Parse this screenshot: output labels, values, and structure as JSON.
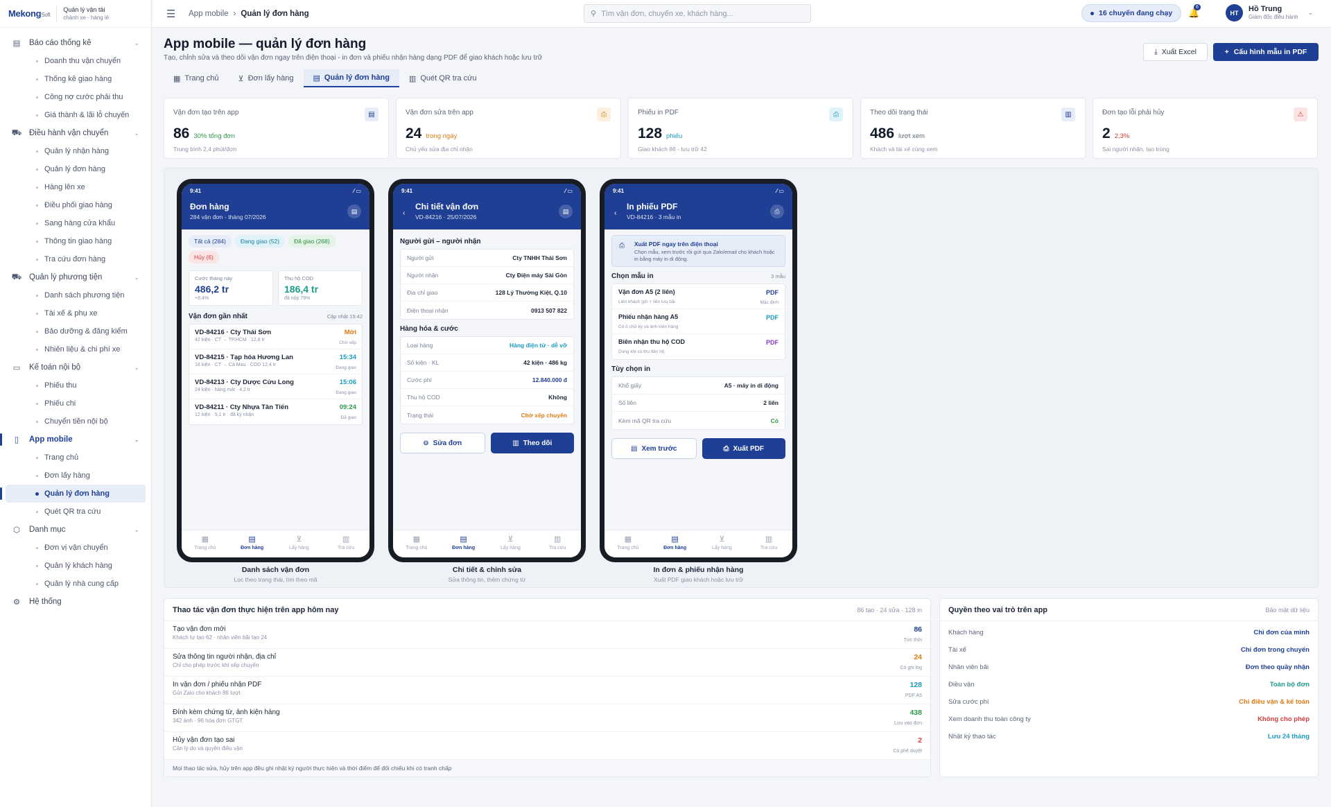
{
  "brand": {
    "logo": "Mekong",
    "logo_suffix": "Soft",
    "line1": "Quản lý vận tải",
    "line2": "chành xe - hàng lẻ"
  },
  "sidebar": {
    "groups": [
      {
        "label": "Báo cáo thống kê",
        "icon": "report-icon",
        "items": [
          "Doanh thu vận chuyển",
          "Thống kê giao hàng",
          "Công nợ cước phải thu",
          "Giá thành & lãi lỗ chuyến"
        ]
      },
      {
        "label": "Điều hành vận chuyển",
        "icon": "truck-icon",
        "items": [
          "Quản lý nhận hàng",
          "Quản lý đơn hàng",
          "Hàng lên xe",
          "Điều phối giao hàng",
          "Sang hàng cửa khẩu",
          "Thông tin giao hàng",
          "Tra cứu đơn hàng"
        ]
      },
      {
        "label": "Quản lý phương tiện",
        "icon": "vehicle-icon",
        "items": [
          "Danh sách phương tiện",
          "Tài xế & phụ xe",
          "Bảo dưỡng & đăng kiểm",
          "Nhiên liệu & chi phí xe"
        ]
      },
      {
        "label": "Kế toán nội bộ",
        "icon": "money-icon",
        "items": [
          "Phiếu thu",
          "Phiếu chi",
          "Chuyển tiền nội bộ"
        ]
      },
      {
        "label": "App mobile",
        "icon": "mobile-icon",
        "items": [
          "Trang chủ",
          "Đơn lấy hàng",
          "Quản lý đơn hàng",
          "Quét QR tra cứu"
        ]
      },
      {
        "label": "Danh mục",
        "icon": "box-icon",
        "items": [
          "Đơn vị vận chuyển",
          "Quản lý khách hàng",
          "Quản lý nhà cung cấp"
        ]
      },
      {
        "label": "Hệ thống",
        "icon": "gear-icon",
        "items": []
      }
    ]
  },
  "topbar": {
    "crumb1": "App mobile",
    "crumb2": "Quản lý đơn hàng",
    "search_placeholder": "Tìm vận đơn, chuyến xe, khách hàng...",
    "trips": "16 chuyến đang chạy",
    "notif": "6",
    "user_initials": "HT",
    "user_name": "Hồ Trung",
    "user_role": "Giám đốc điều hành"
  },
  "page": {
    "title": "App mobile — quản lý đơn hàng",
    "subtitle": "Tạo, chỉnh sửa và theo dõi vận đơn ngay trên điện thoại - in đơn và phiếu nhận hàng dạng PDF để giao khách hoặc lưu trữ",
    "export_excel": "Xuất Excel",
    "config_pdf": "Cấu hình mẫu in PDF"
  },
  "tabs": [
    {
      "label": "Trang chủ",
      "icon": "grid-icon"
    },
    {
      "label": "Đơn lấy hàng",
      "icon": "cart-icon"
    },
    {
      "label": "Quản lý đơn hàng",
      "icon": "doc-icon"
    },
    {
      "label": "Quét QR tra cứu",
      "icon": "map-icon"
    }
  ],
  "kpis": [
    {
      "label": "Vận đơn tạo trên app",
      "value": "86",
      "delta": "30% tổng đơn",
      "note": "Trung bình 2,4 phút/đơn",
      "color": "#2f9a4a",
      "icon": "doc-icon",
      "icon_bg": "#e6ecf8",
      "icon_color": "#1f3f95"
    },
    {
      "label": "Vận đơn sửa trên app",
      "value": "24",
      "delta": "trong ngày",
      "note": "Chủ yếu sửa địa chỉ nhận",
      "color": "#e07a12",
      "icon": "printer-icon",
      "icon_bg": "#fdf0e1",
      "icon_color": "#e07a12"
    },
    {
      "label": "Phiếu in PDF",
      "value": "128",
      "delta": "phiếu",
      "note": "Giao khách 86 - lưu trữ 42",
      "color": "#1a9bbf",
      "icon": "printer-icon",
      "icon_bg": "#e0f3f8",
      "icon_color": "#1a9bbf"
    },
    {
      "label": "Theo dõi trạng thái",
      "value": "486",
      "delta": "lượt xem",
      "note": "Khách và tài xế cùng xem",
      "color": "#5b6579",
      "icon": "map-icon",
      "icon_bg": "#e6ecf8",
      "icon_color": "#1f3f95"
    },
    {
      "label": "Đơn tạo lỗi phải hủy",
      "value": "2",
      "delta": "2,3%",
      "note": "Sai người nhận, tạo trùng",
      "color": "#d63c3c",
      "icon": "warning-icon",
      "icon_bg": "#fbe4e4",
      "icon_color": "#d63c3c"
    }
  ],
  "phone1": {
    "time": "9:41",
    "title": "Đơn hàng",
    "sub": "284 vận đơn - tháng 07/2026",
    "chips": [
      {
        "label": "Tất cả (284)",
        "bg": "#e6ecf8",
        "fg": "#1f3f95"
      },
      {
        "label": "Đang giao (52)",
        "bg": "#e0f3f8",
        "fg": "#1a7fa0"
      },
      {
        "label": "Đã giao (268)",
        "bg": "#e3f4e6",
        "fg": "#2f8a45"
      },
      {
        "label": "Hủy (6)",
        "bg": "#fbe4e4",
        "fg": "#d63c3c"
      }
    ],
    "mini": [
      {
        "label": "Cước tháng này",
        "value": "486,2 tr",
        "note": "+8,4%",
        "color": "#1f3f95"
      },
      {
        "label": "Thu hộ COD",
        "value": "186,4 tr",
        "note": "đã nộp 79%",
        "color": "#1a9b8a"
      }
    ],
    "recent_title": "Vận đơn gần nhất",
    "recent_note": "Cập nhật 15:42",
    "orders": [
      {
        "title": "VD-84216 · Cty Thái Sơn",
        "sub": "42 kiện · CT → TP.HCM · 12,8 tr",
        "right": "Mới",
        "status": "Chờ xếp",
        "color": "#e07a12"
      },
      {
        "title": "VD-84215 · Tạp hóa Hương Lan",
        "sub": "18 kiện · CT → Cà Mau · COD 12,4 tr",
        "right": "15:34",
        "status": "Đang giao",
        "color": "#1a9bbf"
      },
      {
        "title": "VD-84213 · Cty Dược Cửu Long",
        "sub": "24 kiện · hàng mát · 4,2 tr",
        "right": "15:06",
        "status": "Đang giao",
        "color": "#1a9bbf"
      },
      {
        "title": "VD-84211 · Cty Nhựa Tân Tiến",
        "sub": "12 kiện · 5,1 tr · đã ký nhận",
        "right": "09:24",
        "status": "Đã giao",
        "color": "#2f9a4a"
      }
    ]
  },
  "phone2": {
    "time": "9:41",
    "title": "Chi tiết vận đơn",
    "sub": "VD-84216 · 25/07/2026",
    "sec1": "Người gửi – người nhận",
    "rows1": [
      {
        "k": "Người gửi",
        "v": "Cty TNHH Thái Sơn",
        "c": "#1c2536"
      },
      {
        "k": "Người nhận",
        "v": "Cty Điện máy Sài Gòn",
        "c": "#1c2536"
      },
      {
        "k": "Địa chỉ giao",
        "v": "128 Lý Thường Kiệt, Q.10",
        "c": "#1c2536"
      },
      {
        "k": "Điện thoại nhận",
        "v": "0913 507 822",
        "c": "#1c2536"
      }
    ],
    "sec2": "Hàng hóa & cước",
    "rows2": [
      {
        "k": "Loại hàng",
        "v": "Hàng điện tử · dễ vỡ",
        "c": "#1a9bbf"
      },
      {
        "k": "Số kiện · KL",
        "v": "42 kiện · 486 kg",
        "c": "#1c2536"
      },
      {
        "k": "Cước phí",
        "v": "12.840.000 đ",
        "c": "#1f3f95"
      },
      {
        "k": "Thu hộ COD",
        "v": "Không",
        "c": "#1c2536"
      },
      {
        "k": "Trạng thái",
        "v": "Chờ xếp chuyến",
        "c": "#e07a12"
      }
    ],
    "btn_edit": "Sửa đơn",
    "btn_track": "Theo dõi"
  },
  "phone3": {
    "time": "9:41",
    "title": "In phiếu PDF",
    "sub": "VD-84216 · 3 mẫu in",
    "banner_title": "Xuất PDF ngay trên điện thoại",
    "banner_text": "Chọn mẫu, xem trước rồi gửi qua Zalo/email cho khách hoặc in bằng máy in di động.",
    "sec1": "Chọn mẫu in",
    "sec1_note": "3 mẫu",
    "templates": [
      {
        "name": "Vận đơn A5 (2 liên)",
        "desc": "Liên khách gửi + liên lưu bãi",
        "tag": "PDF",
        "tag_note": "Mặc định",
        "color": "#1f3f95"
      },
      {
        "name": "Phiếu nhận hàng A5",
        "desc": "Có ô chữ ký và ảnh kiện hàng",
        "tag": "PDF",
        "tag_note": "",
        "color": "#1a9bbf"
      },
      {
        "name": "Biên nhận thu hộ COD",
        "desc": "Dùng khi có thu tiền hộ",
        "tag": "PDF",
        "tag_note": "",
        "color": "#8a3cc8"
      }
    ],
    "sec2": "Tùy chọn in",
    "options": [
      {
        "k": "Khổ giấy",
        "v": "A5 · máy in di động",
        "c": "#1c2536"
      },
      {
        "k": "Số liên",
        "v": "2 liên",
        "c": "#1c2536"
      },
      {
        "k": "Kèm mã QR tra cứu",
        "v": "Có",
        "c": "#2f9a4a"
      }
    ],
    "btn_preview": "Xem trước",
    "btn_export": "Xuất PDF"
  },
  "phone_nav": [
    "Trang chủ",
    "Đơn hàng",
    "Lấy hàng",
    "Tra cứu"
  ],
  "captions": [
    {
      "title": "Danh sách vận đơn",
      "sub": "Lọc theo trạng thái, tìm theo mã"
    },
    {
      "title": "Chi tiết & chỉnh sửa",
      "sub": "Sửa thông tin, thêm chứng từ"
    },
    {
      "title": "In đơn & phiếu nhận hàng",
      "sub": "Xuất PDF giao khách hoặc lưu trữ"
    }
  ],
  "ops": {
    "title": "Thao tác vận đơn thực hiện trên app hôm nay",
    "note": "86 tạo · 24 sửa · 128 in",
    "rows": [
      {
        "t": "Tạo vận đơn mới",
        "s": "Khách tự tạo 62 · nhân viên bãi tạo 24",
        "v": "86",
        "n": "Tức thời",
        "c": "#1f3f95"
      },
      {
        "t": "Sửa thông tin người nhận, địa chỉ",
        "s": "Chỉ cho phép trước khi xếp chuyến",
        "v": "24",
        "n": "Có ghi log",
        "c": "#e07a12"
      },
      {
        "t": "In vận đơn / phiếu nhận PDF",
        "s": "Gửi Zalo cho khách 86 lượt",
        "v": "128",
        "n": "PDF A5",
        "c": "#1a9bbf"
      },
      {
        "t": "Đính kèm chứng từ, ảnh kiện hàng",
        "s": "342 ảnh · 96 hóa đơn GTGT",
        "v": "438",
        "n": "Lưu vào đơn",
        "c": "#2f9a4a"
      },
      {
        "t": "Hủy vận đơn tạo sai",
        "s": "Cần lý do và quyền điều vận",
        "v": "2",
        "n": "Có phê duyệt",
        "c": "#d63c3c"
      }
    ],
    "footer": "Mọi thao tác sửa, hủy trên app đều ghi nhật ký người thực hiện và thời điểm để đối chiếu khi có tranh chấp"
  },
  "roles": {
    "title": "Quyền theo vai trò trên app",
    "note": "Bảo mật dữ liệu",
    "rows": [
      {
        "k": "Khách hàng",
        "v": "Chỉ đơn của mình",
        "c": "#1f3f95"
      },
      {
        "k": "Tài xế",
        "v": "Chỉ đơn trong chuyến",
        "c": "#1f3f95"
      },
      {
        "k": "Nhân viên bãi",
        "v": "Đơn theo quầy nhận",
        "c": "#1f3f95"
      },
      {
        "k": "Điều vận",
        "v": "Toàn bộ đơn",
        "c": "#1a9b8a"
      },
      {
        "k": "Sửa cước phí",
        "v": "Chỉ điều vận & kế toán",
        "c": "#e07a12"
      },
      {
        "k": "Xem doanh thu toàn công ty",
        "v": "Không cho phép",
        "c": "#d63c3c"
      },
      {
        "k": "Nhật ký thao tác",
        "v": "Lưu 24 tháng",
        "c": "#1a9bbf"
      }
    ]
  }
}
